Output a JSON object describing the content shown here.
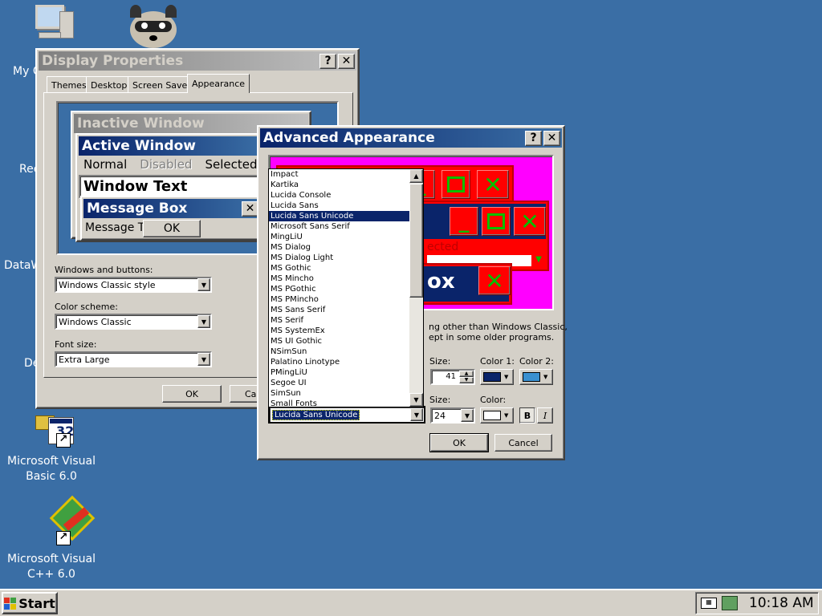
{
  "desktop": {
    "icons": [
      {
        "label": "My C"
      },
      {
        "label": ""
      },
      {
        "label": "Rec"
      },
      {
        "label": "DataW"
      },
      {
        "label": "De"
      },
      {
        "label": "Microsoft Visual Basic 6.0",
        "line1": "Microsoft Visual",
        "line2": "Basic 6.0"
      },
      {
        "label": "Microsoft Visual C++ 6.0",
        "line1": "Microsoft Visual",
        "line2": "C++ 6.0"
      }
    ]
  },
  "display_props": {
    "title": "Display Properties",
    "help_btn": "?",
    "close_btn": "✕",
    "tabs": [
      "Themes",
      "Desktop",
      "Screen Saver",
      "Appearance"
    ],
    "preview": {
      "inactive_title": "Inactive Window",
      "active_title": "Active Window",
      "menu_normal": "Normal",
      "menu_disabled": "Disabled",
      "menu_selected": "Selected",
      "window_text": "Window Text",
      "msgbox_title": "Message Box",
      "msgbox_text": "Message T",
      "msgbox_ok": "OK"
    },
    "windows_buttons_label": "Windows and buttons:",
    "windows_buttons_value": "Windows Classic style",
    "color_scheme_label": "Color scheme:",
    "color_scheme_value": "Windows Classic",
    "font_size_label": "Font size:",
    "font_size_value": "Extra Large",
    "ok": "OK",
    "cancel": "Car"
  },
  "advanced": {
    "title": "Advanced Appearance",
    "help_btn": "?",
    "close_btn": "✕",
    "preview": {
      "fragment_text": "ected",
      "box_text": "ox"
    },
    "info_line1": "ng other than Windows Classic,",
    "info_line2": "ept in some older programs.",
    "size_label": "Size:",
    "size_value": "41",
    "color1_label": "Color 1:",
    "color2_label": "Color 2:",
    "font_size_label": "Size:",
    "font_size_value": "24",
    "color_label": "Color:",
    "bold_btn": "B",
    "italic_btn": "I",
    "font_value": "Lucida Sans Unicode",
    "fonts": [
      "Impact",
      "Kartika",
      "Lucida Console",
      "Lucida Sans",
      "Lucida Sans Unicode",
      "Microsoft Sans Serif",
      "MingLiU",
      "MS Dialog",
      "MS Dialog Light",
      "MS Gothic",
      "MS Mincho",
      "MS PGothic",
      "MS PMincho",
      "MS Sans Serif",
      "MS Serif",
      "MS SystemEx",
      "MS UI Gothic",
      "NSimSun",
      "Palatino Linotype",
      "PMingLiU",
      "Segoe UI",
      "SimSun",
      "Small Fonts"
    ],
    "selected_font_index": 4,
    "ok": "OK",
    "cancel": "Cancel"
  },
  "taskbar": {
    "start": "Start",
    "clock": "10:18 AM"
  },
  "colors": {
    "desktop": "#3a6ea5",
    "title_active": "#0a246a",
    "preview_bg": "#ff00ff",
    "preview_red": "#ff0000",
    "preview_green": "#00c000",
    "color1": "#0a246a",
    "color2": "#3a90d0"
  }
}
